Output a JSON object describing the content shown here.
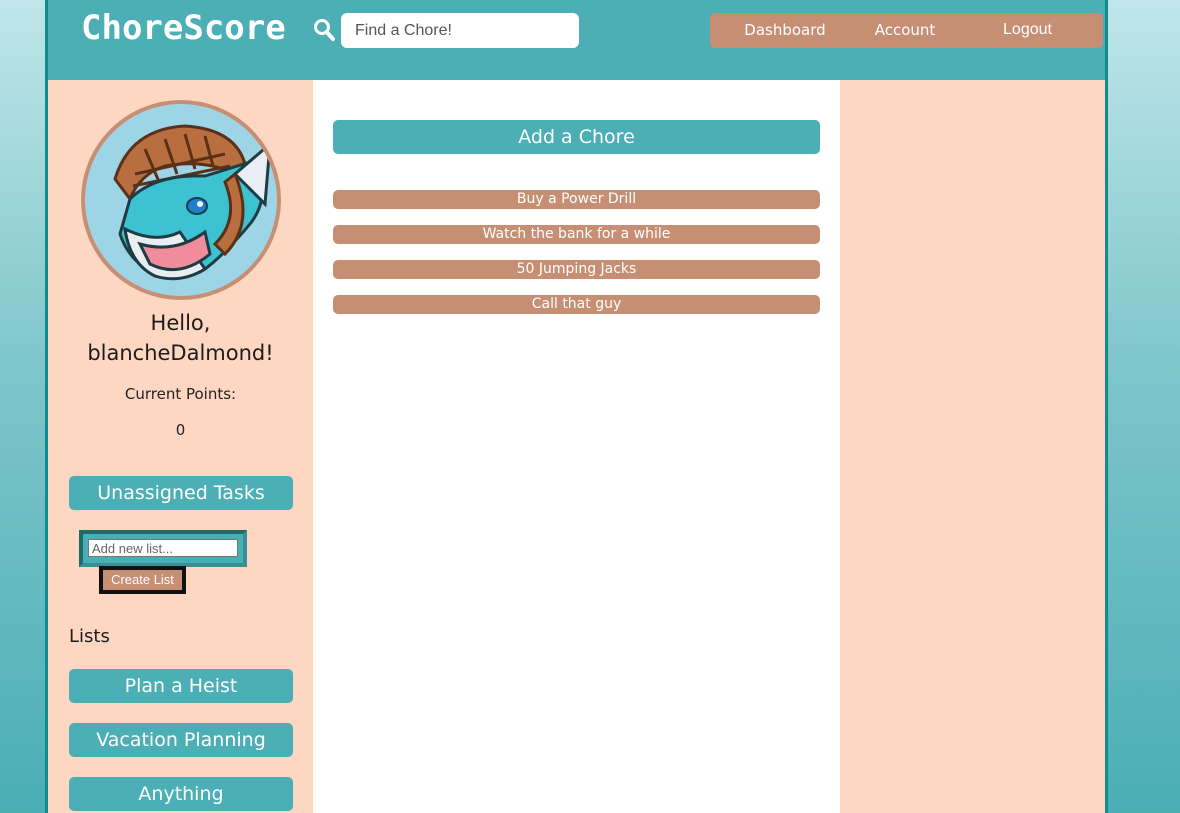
{
  "header": {
    "logo": "ChoreScore",
    "search": {
      "placeholder": "Find a Chore!",
      "icon": "search-icon"
    },
    "nav": {
      "dashboard": "Dashboard",
      "account": "Account",
      "logout": "Logout"
    }
  },
  "sidebar": {
    "greeting_line1": "Hello,",
    "greeting_line2": "blancheDalmond!",
    "points_label": "Current Points:",
    "points_value": "0",
    "unassigned_tasks": "Unassigned Tasks",
    "new_list_placeholder": "Add new list...",
    "create_list": "Create List",
    "lists_heading": "Lists",
    "lists": [
      "Plan a Heist",
      "Vacation Planning",
      "Anything"
    ]
  },
  "main": {
    "add_chore": "Add a Chore",
    "chores": [
      "Buy a Power Drill",
      "Watch the bank for a while",
      "50 Jumping Jacks",
      "Call that guy"
    ]
  },
  "colors": {
    "teal": "#4cafb6",
    "tan": "#c68f74",
    "peach": "#fed7c3",
    "border": "#138a8e"
  }
}
